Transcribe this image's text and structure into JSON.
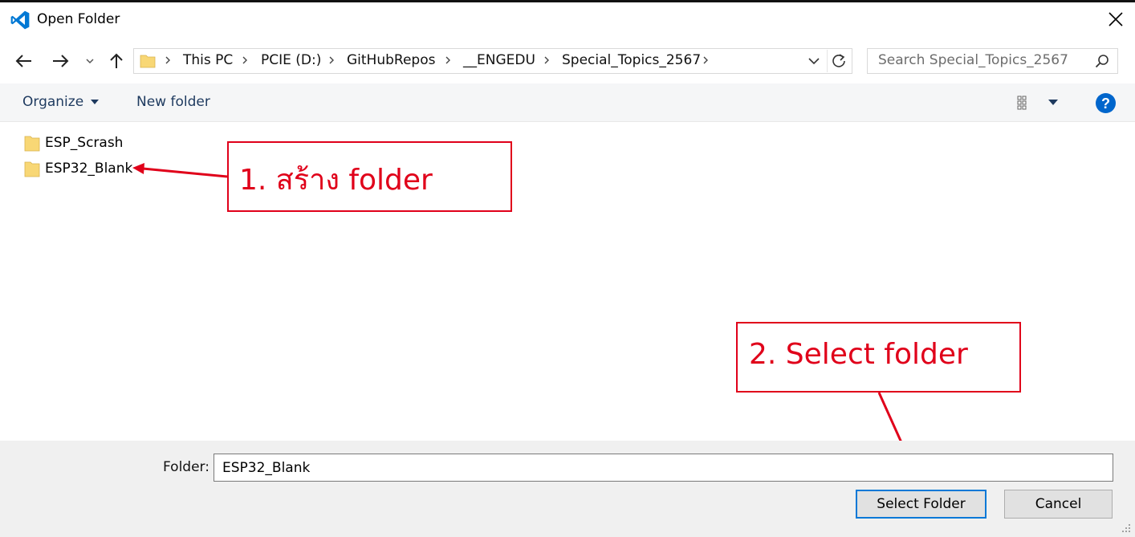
{
  "window": {
    "title": "Open Folder"
  },
  "navigation": {
    "breadcrumbs": [
      "This PC",
      "PCIE (D:)",
      "GitHubRepos",
      "__ENGEDU",
      "Special_Topics_2567"
    ],
    "search_placeholder": "Search Special_Topics_2567"
  },
  "toolbar": {
    "organize_label": "Organize",
    "new_folder_label": "New folder"
  },
  "files": [
    {
      "name": "ESP_Scrash",
      "type": "folder"
    },
    {
      "name": "ESP32_Blank",
      "type": "folder"
    }
  ],
  "annotations": {
    "step1": "1.  สร้าง  folder",
    "step2": "2.  Select  folder",
    "color": "#e0001a"
  },
  "footer": {
    "folder_label": "Folder:",
    "folder_value": "ESP32_Blank",
    "select_button": "Select Folder",
    "cancel_button": "Cancel"
  },
  "colors": {
    "vscode_blue": "#0078d4",
    "folder_yellow": "#f8d775",
    "help_blue": "#0066cc"
  }
}
